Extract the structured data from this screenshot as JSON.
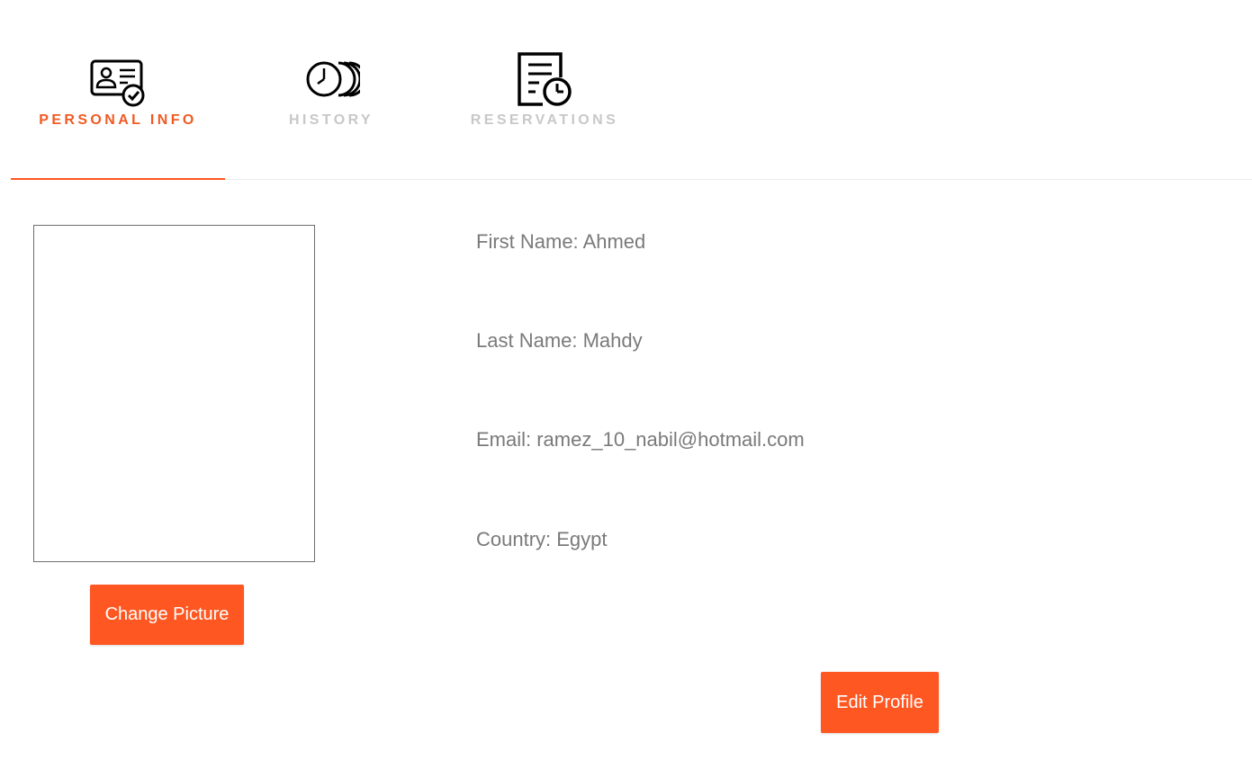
{
  "colors": {
    "accent": "#ff5722",
    "tab_active": "#f05a22",
    "tab_inactive": "#c8c8c8",
    "info_text": "#7a7a7a",
    "button_text": "#ffffff"
  },
  "tabs": [
    {
      "label": "PERSONAL INFO",
      "icon": "id-card-check-icon",
      "active": true
    },
    {
      "label": "HISTORY",
      "icon": "history-clock-icon",
      "active": false
    },
    {
      "label": "RESERVATIONS",
      "icon": "document-clock-icon",
      "active": false
    }
  ],
  "profile": {
    "change_picture_label": "Change Picture",
    "edit_profile_label": "Edit Profile",
    "first_name": "First Name: Ahmed",
    "last_name": "Last Name: Mahdy",
    "email": "Email: ramez_10_nabil@hotmail.com",
    "country": "Country: Egypt"
  }
}
